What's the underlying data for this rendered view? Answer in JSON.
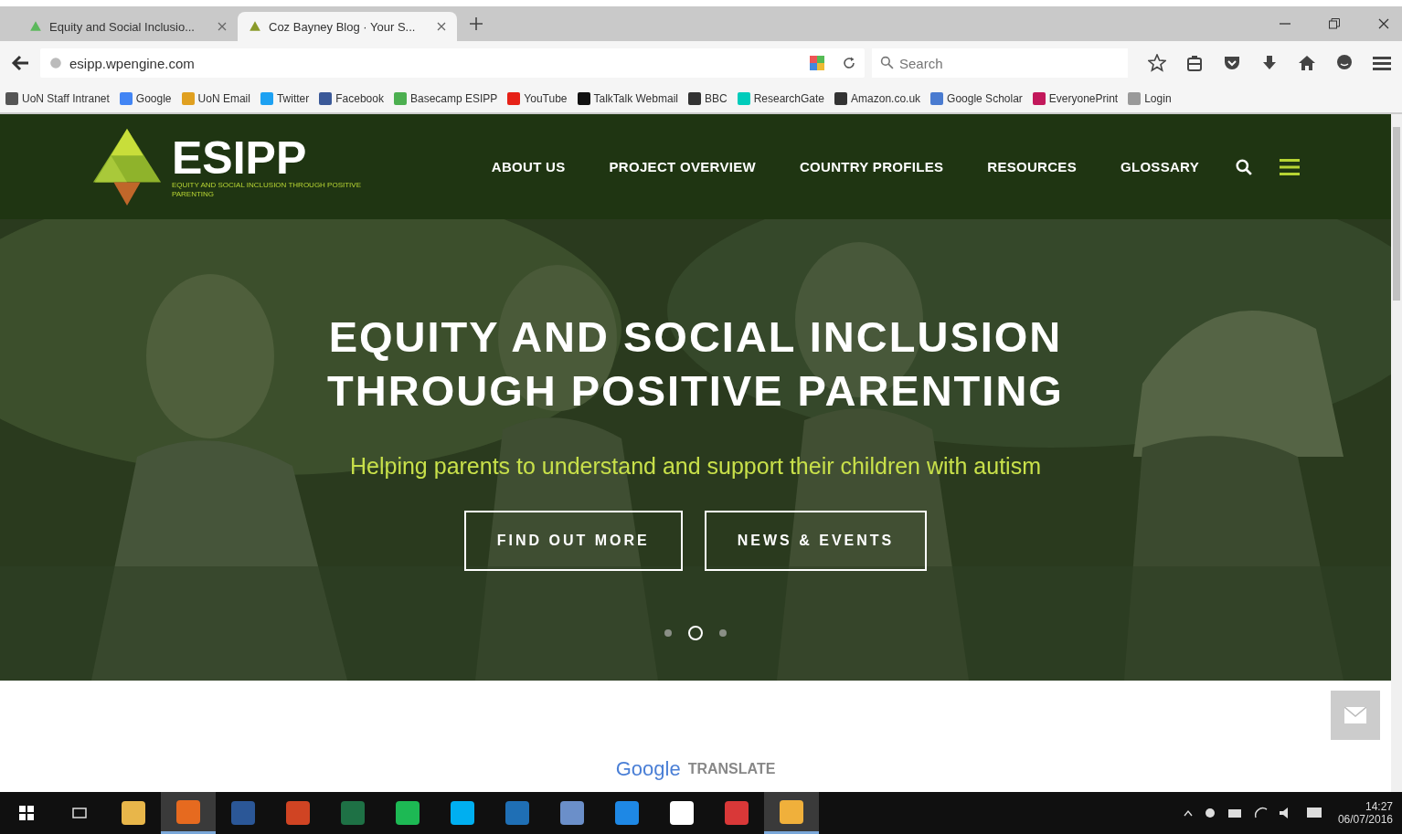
{
  "browser": {
    "tabs": [
      {
        "label": "Equity and Social Inclusio...",
        "selected": false
      },
      {
        "label": "Coz Bayney Blog · Your S...",
        "selected": true
      }
    ],
    "address": "esipp.wpengine.com",
    "search": {
      "placeholder": "Search"
    },
    "bookmarks": [
      "UoN Staff Intranet",
      "Google",
      "UoN Email",
      "Twitter",
      "Facebook",
      "Basecamp ESIPP",
      "YouTube",
      "TalkTalk Webmail",
      "BBC",
      "ResearchGate",
      "Amazon.co.uk",
      "Google Scholar",
      "EveryonePrint",
      "Login"
    ]
  },
  "site": {
    "logo": {
      "name": "ESIPP",
      "tagline": "EQUITY AND SOCIAL INCLUSION THROUGH POSITIVE PARENTING"
    },
    "nav": [
      "ABOUT US",
      "PROJECT OVERVIEW",
      "COUNTRY PROFILES",
      "RESOURCES",
      "GLOSSARY"
    ],
    "hero": {
      "title": "EQUITY AND SOCIAL INCLUSION THROUGH POSITIVE PARENTING",
      "subtitle": "Helping parents to understand and support their children with autism",
      "buttons": [
        "FIND OUT MORE",
        "NEWS & EVENTS"
      ],
      "dots": [
        {
          "selected": false
        },
        {
          "selected": true
        },
        {
          "selected": false
        }
      ]
    },
    "translate": {
      "brand": "Google",
      "label": "TRANSLATE"
    }
  },
  "taskbar": {
    "apps": [
      {
        "selected": false
      },
      {
        "selected": true
      },
      {
        "selected": false
      },
      {
        "selected": false
      },
      {
        "selected": false
      },
      {
        "selected": false
      },
      {
        "selected": false
      },
      {
        "selected": false
      },
      {
        "selected": false
      },
      {
        "selected": false
      },
      {
        "selected": false
      },
      {
        "selected": false
      },
      {
        "selected": true
      }
    ],
    "time": "14:27",
    "date": "06/07/2016"
  }
}
